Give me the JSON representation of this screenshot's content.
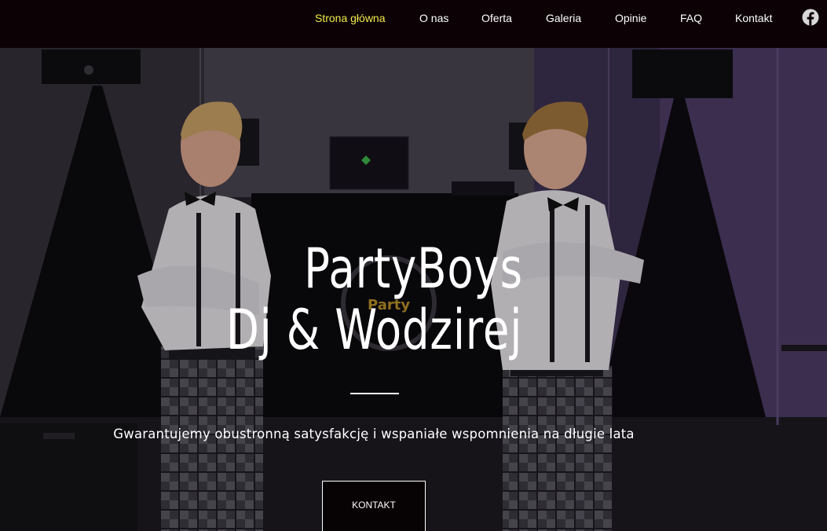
{
  "nav": {
    "items": [
      {
        "label": "Strona główna",
        "active": true
      },
      {
        "label": "O nas",
        "active": false
      },
      {
        "label": "Oferta",
        "active": false
      },
      {
        "label": "Galeria",
        "active": false
      },
      {
        "label": "Opinie",
        "active": false
      },
      {
        "label": "FAQ",
        "active": false
      },
      {
        "label": "Kontakt",
        "active": false
      }
    ],
    "social_icon": "facebook-icon",
    "active_color": "#f2ea4a"
  },
  "hero": {
    "title_line1": "PartyBoys",
    "title_line2": "Dj & Wodzirej",
    "tagline": "Gwarantujemy obustronną satysfakcję i wspaniałe wspomnienia na długie lata",
    "cta_label": "KONTAKT",
    "image_description_icon": "photo-two-djs"
  }
}
